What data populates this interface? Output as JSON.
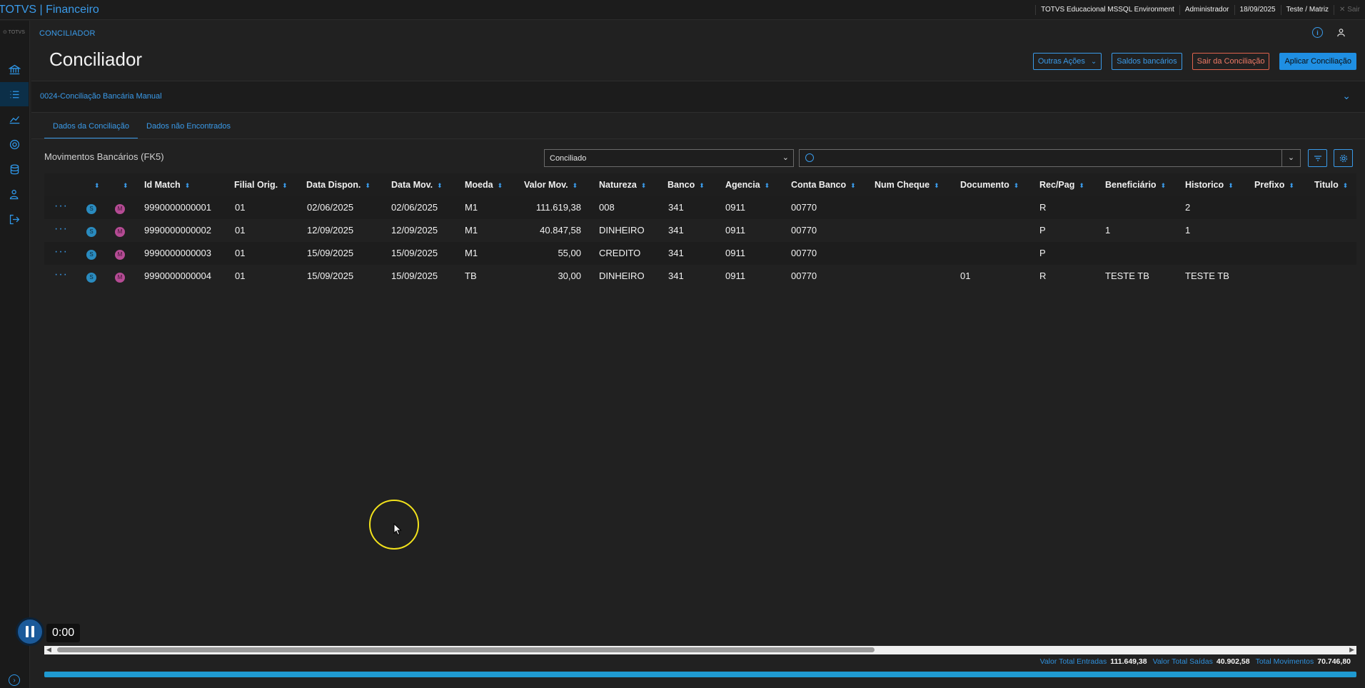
{
  "topbar": {
    "app_title": "TOTVS | Financeiro",
    "environment": "TOTVS Educacional MSSQL Environment",
    "user": "Administrador",
    "date": "18/09/2025",
    "company": "Teste / Matriz",
    "exit": "✕ Sair"
  },
  "sidebar": {
    "logo": "⊙ TOTVS"
  },
  "breadcrumb": "CONCILIADOR",
  "page_title": "Conciliador",
  "actions": {
    "other": "Outras Ações",
    "balances": "Saldos bancários",
    "exit_reconciliation": "Sair da Conciliação",
    "apply": "Aplicar Conciliação"
  },
  "panel_title": "0024-Conciliação Bancária Manual",
  "tabs": [
    "Dados da Conciliação",
    "Dados não Encontrados"
  ],
  "grid": {
    "title": "Movimentos Bancários (FK5)",
    "status_value": "Conciliado",
    "search_placeholder": "",
    "columns": [
      "Id Match",
      "Filial Orig.",
      "Data Dispon.",
      "Data Mov.",
      "Moeda",
      "Valor Mov.",
      "Natureza",
      "Banco",
      "Agencia",
      "Conta Banco",
      "Num Cheque",
      "Documento",
      "Rec/Pag",
      "Beneficiário",
      "Historico",
      "Prefixo",
      "Titulo"
    ],
    "rows": [
      {
        "id": "9990000000001",
        "filial": "01",
        "disp": "02/06/2025",
        "mov": "02/06/2025",
        "moeda": "M1",
        "valor": "111.619,38",
        "natureza": "008",
        "banco": "341",
        "agencia": "0911",
        "conta": "00770",
        "cheque": "",
        "doc": "",
        "recpag": "R",
        "benef": "",
        "hist": "2"
      },
      {
        "id": "9990000000002",
        "filial": "01",
        "disp": "12/09/2025",
        "mov": "12/09/2025",
        "moeda": "M1",
        "valor": "40.847,58",
        "natureza": "DINHEIRO",
        "banco": "341",
        "agencia": "0911",
        "conta": "00770",
        "cheque": "",
        "doc": "",
        "recpag": "P",
        "benef": "1",
        "hist": "1"
      },
      {
        "id": "9990000000003",
        "filial": "01",
        "disp": "15/09/2025",
        "mov": "15/09/2025",
        "moeda": "M1",
        "valor": "55,00",
        "natureza": "CREDITO",
        "banco": "341",
        "agencia": "0911",
        "conta": "00770",
        "cheque": "",
        "doc": "",
        "recpag": "P",
        "benef": "",
        "hist": ""
      },
      {
        "id": "9990000000004",
        "filial": "01",
        "disp": "15/09/2025",
        "mov": "15/09/2025",
        "moeda": "TB",
        "valor": "30,00",
        "natureza": "DINHEIRO",
        "banco": "341",
        "agencia": "0911",
        "conta": "00770",
        "cheque": "",
        "doc": "01",
        "recpag": "R",
        "benef": "TESTE TB",
        "hist": "TESTE TB"
      }
    ],
    "badge_s": "S",
    "badge_m": "M"
  },
  "totals": {
    "in_label": "Valor Total Entradas",
    "in_value": "111.649,38",
    "out_label": "Valor Total Saídas",
    "out_value": "40.902,58",
    "total_label": "Total Movimentos",
    "total_value": "70.746,80"
  },
  "video": {
    "timecode": "0:00"
  },
  "colors": {
    "accent": "#3a9bea",
    "danger": "#e0634d",
    "background": "#212121"
  }
}
